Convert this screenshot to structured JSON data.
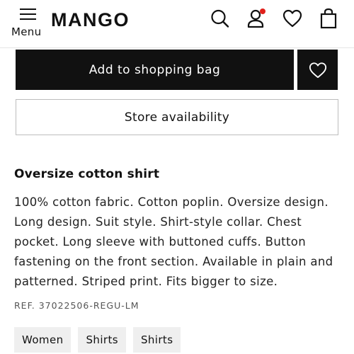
{
  "header": {
    "menu_label": "Menu",
    "logo": "MANGO",
    "icons": [
      "menu-icon",
      "search-icon",
      "user-icon",
      "heart-icon",
      "bag-icon"
    ],
    "notification_color": "#e0201b"
  },
  "actions": {
    "add_to_bag_label": "Add to shopping bag",
    "store_availability_label": "Store availability"
  },
  "product": {
    "title": "Oversize cotton shirt",
    "description": "100% cotton fabric. Cotton poplin. Oversize design. Long design. Suit style. Shirt-style collar. Chest pocket. Long sleeve with buttoned cuffs. Button fastening on the front section. Available in plain and patterned. Striped print. Fits bigger to size.",
    "reference": "REF. 37022506-REGU-LM"
  },
  "tags": [
    "Women",
    "Shirts",
    "Shirts"
  ],
  "colors": {
    "primary_button": "#111111",
    "tag_background": "#efefef"
  }
}
